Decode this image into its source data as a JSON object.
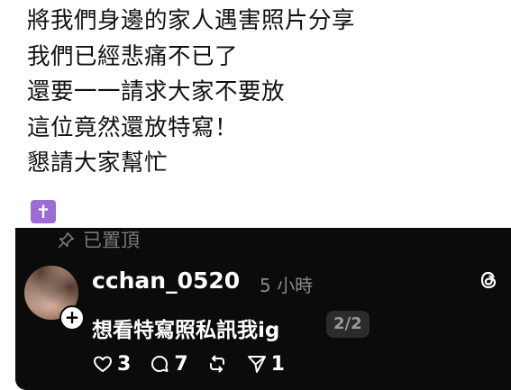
{
  "post": {
    "lines": [
      "將我們身邊的家人遇害照片分享",
      "我們已經悲痛不已了",
      "還要一一請求大家不要放",
      "這位竟然還放特寫！",
      "懇請大家幫忙"
    ],
    "emoji": "✝"
  },
  "comment": {
    "pinned_label": "已置頂",
    "username": "cchan_0520",
    "timestamp": "5 小時",
    "text": "想看特寫照私訊我ig",
    "page_badge": "2/2",
    "likes": "3",
    "replies": "7",
    "shares": "1"
  }
}
